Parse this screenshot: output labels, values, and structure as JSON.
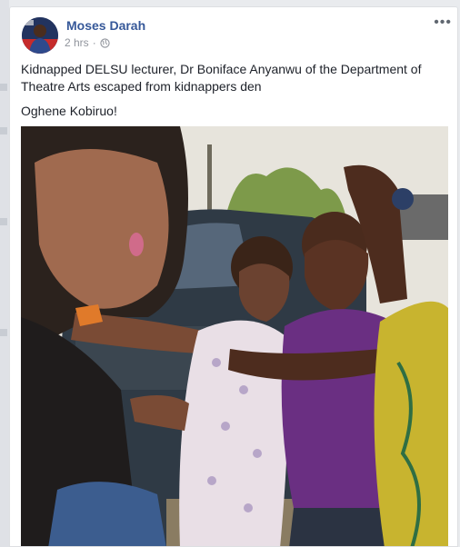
{
  "post": {
    "author": "Moses Darah",
    "time": "2 hrs",
    "separator": "·",
    "more_menu": "•••",
    "audience_icon": "globe-icon",
    "paragraphs": [
      "Kidnapped DELSU lecturer, Dr Boniface Anyanwu of the Department of Theatre Arts escaped from kidnappers den",
      "Oghene Kobiruo!"
    ]
  },
  "colors": {
    "author_link": "#365899",
    "meta_gray": "#90949c",
    "page_bg": "#e9ebee"
  }
}
